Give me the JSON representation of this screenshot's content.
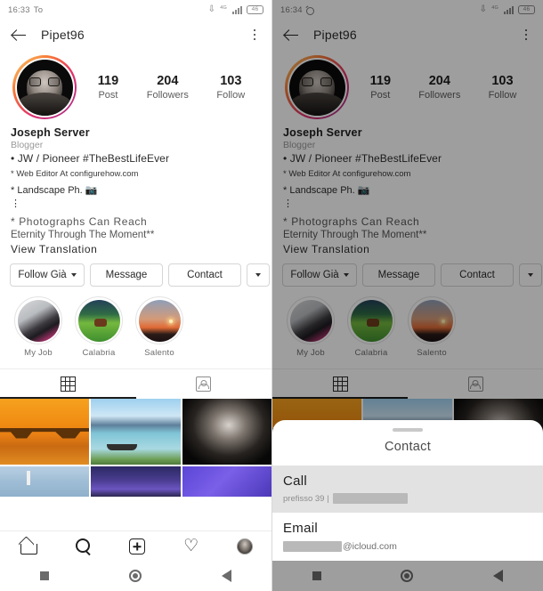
{
  "left": {
    "statusbar": {
      "time": "16:33",
      "day": "To",
      "battery": "46",
      "network": "4G"
    },
    "appbar": {
      "username": "Pipet96",
      "back_icon": "back-arrow-icon",
      "menu_icon": "kebab-menu-icon"
    },
    "stats": [
      {
        "num": "119",
        "label": "Post"
      },
      {
        "num": "204",
        "label": "Followers"
      },
      {
        "num": "103",
        "label": "Follow"
      }
    ],
    "bio": {
      "name": "Joseph Server",
      "category": "Blogger",
      "line1": "• JW / Pioneer #TheBestLifeEver",
      "line2": "* Web Editor At configurehow.com",
      "line3": "* Landscape Ph. 📷",
      "line4": "⋮",
      "line5": "* Photographs Can Reach",
      "line6": "Eternity Through The Moment**",
      "view_translation": "View Translation"
    },
    "actions": {
      "follow": "Follow Già",
      "message": "Message",
      "contact": "Contact",
      "more": "⌄"
    },
    "highlights": [
      {
        "label": "My Job"
      },
      {
        "label": "Calabria"
      },
      {
        "label": "Salento"
      }
    ],
    "tabs": [
      {
        "name": "grid",
        "icon": "grid-icon",
        "active": true
      },
      {
        "name": "tagged",
        "icon": "tagged-person-icon",
        "active": false
      }
    ],
    "bottomnav": [
      {
        "icon": "home-icon"
      },
      {
        "icon": "search-icon"
      },
      {
        "icon": "add-post-icon"
      },
      {
        "icon": "heart-activity-icon"
      },
      {
        "icon": "profile-avatar-icon"
      }
    ],
    "sysnav": [
      {
        "icon": "recents-square-icon"
      },
      {
        "icon": "home-circle-icon"
      },
      {
        "icon": "back-triangle-icon"
      }
    ]
  },
  "right": {
    "statusbar": {
      "time": "16:34",
      "day": "",
      "battery": "46",
      "network": "4G",
      "alarm_icon": "alarm-clock-icon"
    },
    "sheet": {
      "title": "Contact",
      "handle": "drag-handle",
      "rows": [
        {
          "title": "Call",
          "sub_prefix": "prefisso 39 |",
          "sub_redacted": true,
          "selected": true
        },
        {
          "title": "Email",
          "sub_suffix": "@icloud.com",
          "sub_redacted": true,
          "selected": false
        }
      ]
    }
  }
}
